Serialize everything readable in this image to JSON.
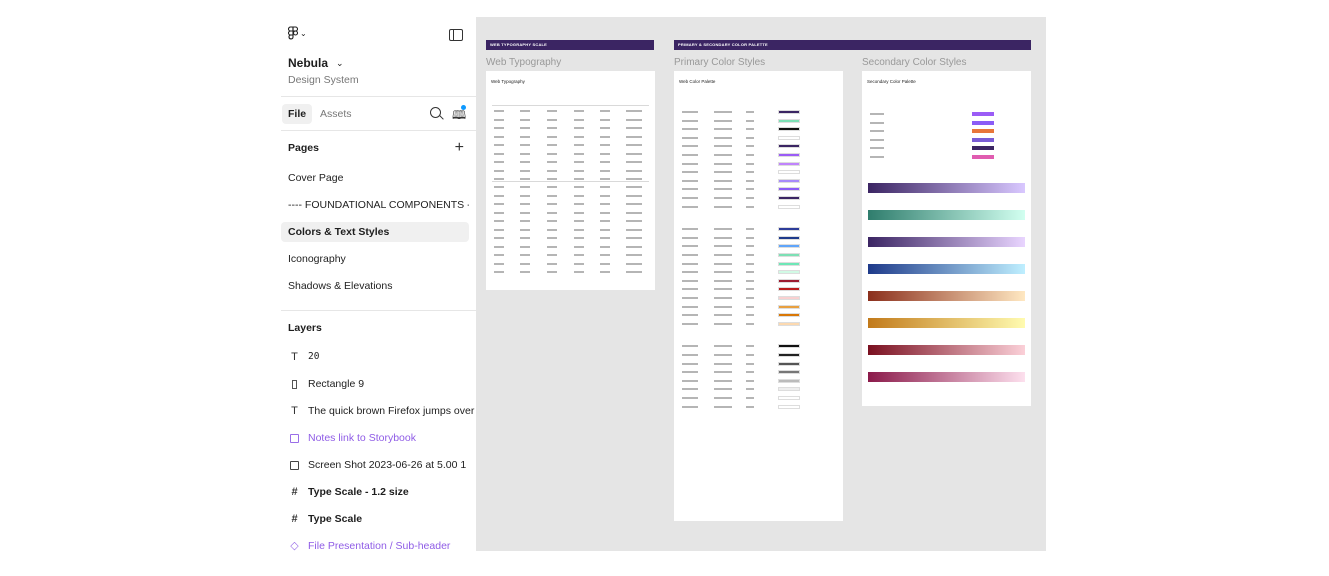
{
  "app": {
    "project_name": "Nebula",
    "project_subtitle": "Design System"
  },
  "tabs": [
    {
      "label": "File",
      "active": true
    },
    {
      "label": "Assets",
      "active": false
    }
  ],
  "pages": {
    "header": "Pages",
    "items": [
      {
        "label": "Cover Page",
        "selected": false
      },
      {
        "label": "---- FOUNDATIONAL COMPONENTS -...",
        "selected": false
      },
      {
        "label": "Colors & Text Styles",
        "selected": true
      },
      {
        "label": "Iconography",
        "selected": false
      },
      {
        "label": "Shadows & Elevations",
        "selected": false
      }
    ]
  },
  "layers": {
    "header": "Layers",
    "items": [
      {
        "label": "20",
        "icon": "text-icon",
        "style": "normal"
      },
      {
        "label": "Rectangle 9",
        "icon": "rectangle-icon",
        "style": "normal"
      },
      {
        "label": "The quick brown Firefox jumps over th",
        "icon": "text-icon",
        "style": "normal"
      },
      {
        "label": "Notes link to Storybook",
        "icon": "sticky-note-icon",
        "style": "purple"
      },
      {
        "label": "Screen Shot 2023-06-26 at 5.00 1",
        "icon": "image-icon",
        "style": "normal"
      },
      {
        "label": "Type Scale - 1.2 size",
        "icon": "frame-icon",
        "style": "bold"
      },
      {
        "label": "Type Scale",
        "icon": "frame-icon",
        "style": "bold"
      },
      {
        "label": "File Presentation / Sub-header",
        "icon": "component-icon",
        "style": "purple"
      }
    ]
  },
  "canvas": {
    "banners": [
      {
        "label": "WEB TYPOGRAPHY SCALE"
      },
      {
        "label": "PRIMARY & SECONDARY COLOR PALETTE"
      }
    ],
    "frames": [
      {
        "title": "Web Typography",
        "board_title": "Web Typography"
      },
      {
        "title": "Primary Color Styles",
        "board_title": "Web Color Palette"
      },
      {
        "title": "Secondary Color Styles",
        "board_title": "Secondary Color Palette"
      }
    ]
  },
  "colors": {
    "banner": "#3b2563",
    "accent": "#0d99ff",
    "component_purple": "#8f5ce6",
    "canvas": "#e5e5e5"
  }
}
